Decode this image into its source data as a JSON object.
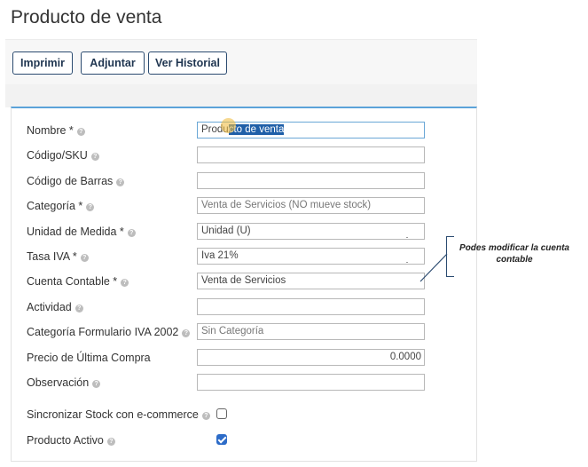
{
  "page": {
    "title": "Producto de venta"
  },
  "toolbar": {
    "print": "Imprimir",
    "attach": "Adjuntar",
    "history": "Ver Historial"
  },
  "form": {
    "name": {
      "label": "Nombre *",
      "value_start": "Produ",
      "value_end": "cto de venta"
    },
    "sku": {
      "label": "Código/SKU",
      "value": ""
    },
    "barcode": {
      "label": "Código de Barras",
      "value": ""
    },
    "category": {
      "label": "Categoría *",
      "value": "Venta de Servicios (NO mueve stock)"
    },
    "unit": {
      "label": "Unidad de Medida *",
      "value": "Unidad (U)"
    },
    "vat": {
      "label": "Tasa IVA *",
      "value": "Iva 21%"
    },
    "account": {
      "label": "Cuenta Contable *",
      "value": "Venta de Servicios"
    },
    "activity": {
      "label": "Actividad",
      "value": ""
    },
    "form_category": {
      "label": "Categoría Formulario IVA 2002",
      "value": "Sin Categoría"
    },
    "last_price": {
      "label": "Precio de Última Compra",
      "value": "0.0000"
    },
    "notes": {
      "label": "Observación",
      "value": ""
    },
    "sync_stock": {
      "label": "Sincronizar Stock con e-commerce",
      "checked": false
    },
    "active": {
      "label": "Producto Activo",
      "checked": true
    }
  },
  "callout": {
    "text": "Podes modificar la cuenta contable"
  },
  "icons": {
    "help": "question-circle-icon",
    "check": "checkmark-icon"
  },
  "colors": {
    "accent": "#5ba3d9",
    "button_border": "#2b4b70",
    "checkbox": "#2d6cc8",
    "selection": "#1f5fa8"
  }
}
